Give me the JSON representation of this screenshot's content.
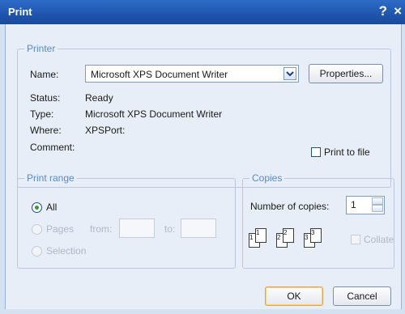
{
  "title": "Print",
  "title_help": "?",
  "title_close": "×",
  "printer": {
    "legend": "Printer",
    "name_label": "Name:",
    "name_value": "Microsoft XPS Document Writer",
    "properties_label": "Properties...",
    "status_label": "Status:",
    "status_value": "Ready",
    "type_label": "Type:",
    "type_value": "Microsoft XPS Document Writer",
    "where_label": "Where:",
    "where_value": "XPSPort:",
    "comment_label": "Comment:",
    "print_to_file_label": "Print to file",
    "print_to_file_checked": false
  },
  "print_range": {
    "legend": "Print range",
    "all_label": "All",
    "pages_label": "Pages",
    "from_label": "from:",
    "to_label": "to:",
    "selection_label": "Selection"
  },
  "copies": {
    "legend": "Copies",
    "number_label": "Number of copies:",
    "number_value": "1",
    "collate_label": "Collate"
  },
  "buttons": {
    "ok": "OK",
    "cancel": "Cancel"
  }
}
